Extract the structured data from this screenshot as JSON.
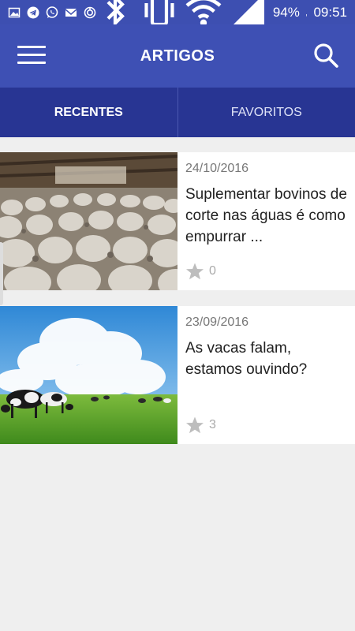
{
  "status_bar": {
    "battery": "94%",
    "time": "09:51",
    "icons_left": [
      "image-icon",
      "telegram-icon",
      "whatsapp-icon",
      "gmail-icon",
      "sync-icon"
    ],
    "icons_right": [
      "bluetooth-icon",
      "vibrate-icon",
      "wifi-icon",
      "signal-icon",
      "battery-icon"
    ]
  },
  "app_bar": {
    "title": "ARTIGOS",
    "menu_icon": "hamburger-menu-icon",
    "search_icon": "search-icon"
  },
  "tabs": [
    {
      "label": "RECENTES",
      "active": true
    },
    {
      "label": "FAVORITOS",
      "active": false
    }
  ],
  "articles": [
    {
      "date": "24/10/2016",
      "title": "Suplementar bovinos de corte nas águas é como empurrar  ...",
      "favorites": "0",
      "image": "cattle-herd-photo"
    },
    {
      "date": "23/09/2016",
      "title": "As vacas falam, estamos ouvindo?",
      "favorites": "3",
      "image": "cows-grazing-field-photo"
    }
  ],
  "colors": {
    "primary": "#3e50b4",
    "tab_bar": "#283593",
    "background": "#efefef"
  }
}
